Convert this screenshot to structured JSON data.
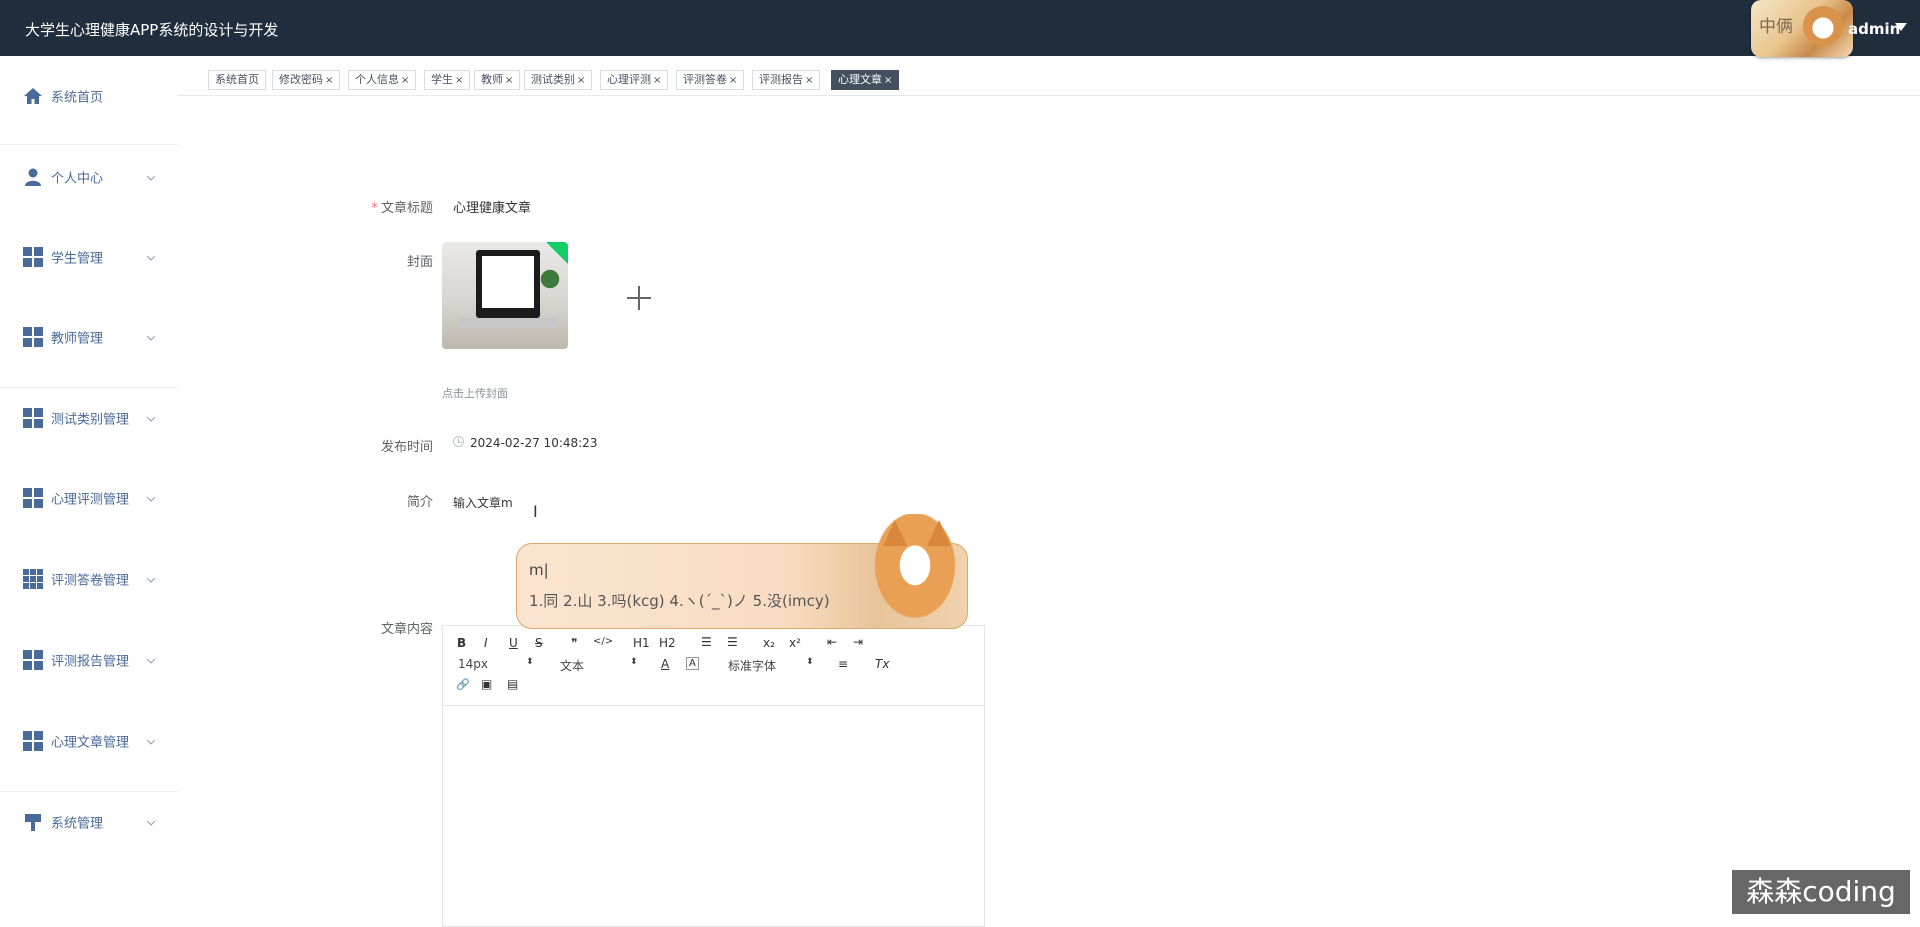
{
  "app": {
    "title": "大学生心理健康APP系统的设计与开发"
  },
  "user": {
    "name": "admin",
    "ime_badge": "中俩"
  },
  "sidebar": {
    "items": [
      {
        "label": "系统首页",
        "icon": "home-icon"
      },
      {
        "label": "个人中心",
        "icon": "person-icon"
      },
      {
        "label": "学生管理",
        "icon": "grid-icon"
      },
      {
        "label": "教师管理",
        "icon": "grid-icon"
      },
      {
        "label": "测试类别管理",
        "icon": "grid-icon"
      },
      {
        "label": "心理评测管理",
        "icon": "grid-icon"
      },
      {
        "label": "评测答卷管理",
        "icon": "grid9-icon"
      },
      {
        "label": "评测报告管理",
        "icon": "grid-icon"
      },
      {
        "label": "心理文章管理",
        "icon": "grid-icon"
      },
      {
        "label": "系统管理",
        "icon": "brush-icon"
      }
    ]
  },
  "tags": [
    {
      "label": "系统首页",
      "closable": false
    },
    {
      "label": "修改密码",
      "closable": true
    },
    {
      "label": "个人信息",
      "closable": true
    },
    {
      "label": "学生",
      "closable": true
    },
    {
      "label": "教师",
      "closable": true
    },
    {
      "label": "测试类别",
      "closable": true
    },
    {
      "label": "心理评测",
      "closable": true
    },
    {
      "label": "评测答卷",
      "closable": true
    },
    {
      "label": "评测报告",
      "closable": true
    },
    {
      "label": "心理文章",
      "closable": true,
      "active": true
    }
  ],
  "tag_close_glyph": "×",
  "form": {
    "title_label": "文章标题",
    "title_required_mark": "*",
    "title_value": "心理健康文章",
    "cover_label": "封面",
    "cover_tip": "点击上传封面",
    "time_label": "发布时间",
    "time_value": "2024-02-27 10:48:23",
    "intro_label": "简介",
    "intro_value": "输入文章m",
    "content_label": "文章内容"
  },
  "ime": {
    "input": "m|",
    "candidates": "1.同  2.山  3.吗(kcg)  4.ヽ(ˊ_ˋ)ノ  5.没(imcy)"
  },
  "editor": {
    "row1": [
      "B",
      "I",
      "U",
      "S",
      "❞",
      "</>",
      "H1",
      "H2",
      "☰",
      "☰",
      "x₂",
      "x²",
      "⇤",
      "⇥"
    ],
    "font_size": "14px",
    "header_select": "文本",
    "font_family": "标准字体",
    "select_arrow": "⬍",
    "font_color": "A",
    "bg_color": "A",
    "align": "≡",
    "clear": "Tx",
    "row3": [
      "🔗",
      "▣",
      "▤"
    ]
  },
  "watermark": "森森coding",
  "colors": {
    "topbar": "#1f2d3d",
    "sidebar_text": "#4a6a9a",
    "active_tag": "#42505f",
    "required": "#f56c6c"
  }
}
